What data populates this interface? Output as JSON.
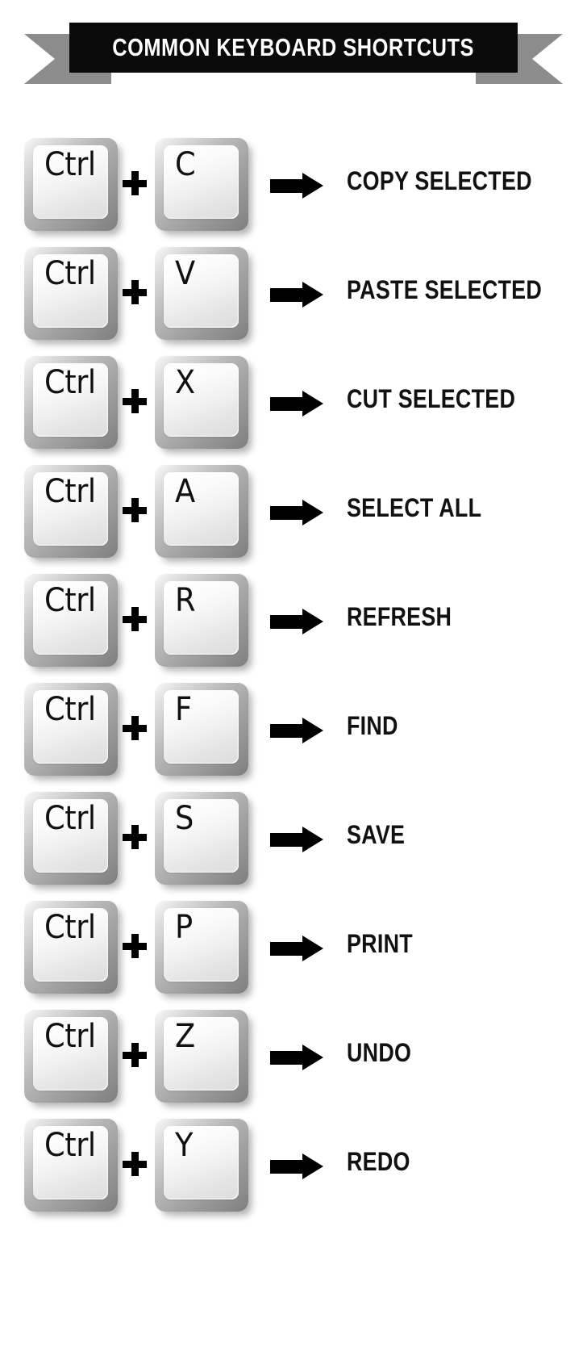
{
  "banner": {
    "title": "COMMON KEYBOARD SHORTCUTS",
    "plate_color": "#0a0a0a",
    "tail_color": "#8c8c8c",
    "title_color": "#ffffff"
  },
  "modifier_label": "Ctrl",
  "combiner_symbol": "+",
  "arrow_symbol": "→",
  "background_color": "#ffffff",
  "shortcuts": [
    {
      "modifier": "Ctrl",
      "key": "C",
      "action": "COPY SELECTED"
    },
    {
      "modifier": "Ctrl",
      "key": "V",
      "action": "PASTE SELECTED"
    },
    {
      "modifier": "Ctrl",
      "key": "X",
      "action": "CUT SELECTED"
    },
    {
      "modifier": "Ctrl",
      "key": "A",
      "action": "SELECT ALL"
    },
    {
      "modifier": "Ctrl",
      "key": "R",
      "action": "REFRESH"
    },
    {
      "modifier": "Ctrl",
      "key": "F",
      "action": "FIND"
    },
    {
      "modifier": "Ctrl",
      "key": "S",
      "action": "SAVE"
    },
    {
      "modifier": "Ctrl",
      "key": "P",
      "action": "PRINT"
    },
    {
      "modifier": "Ctrl",
      "key": "Z",
      "action": "UNDO"
    },
    {
      "modifier": "Ctrl",
      "key": "Y",
      "action": "REDO"
    }
  ]
}
